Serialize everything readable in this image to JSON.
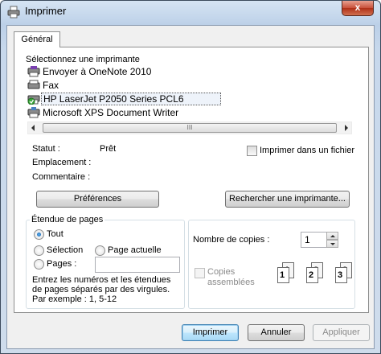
{
  "window": {
    "title": "Imprimer",
    "close_label": "x"
  },
  "tabs": [
    {
      "label": "Général"
    }
  ],
  "printer_group": {
    "legend": "Sélectionnez une imprimante",
    "printers": [
      {
        "name": "Envoyer à OneNote 2010",
        "icon": "onenote-printer-icon",
        "selected": false
      },
      {
        "name": "Fax",
        "icon": "fax-printer-icon",
        "selected": false
      },
      {
        "name": "HP LaserJet P2050 Series PCL6",
        "icon": "default-printer-icon",
        "selected": true
      },
      {
        "name": "Microsoft XPS Document Writer",
        "icon": "xps-printer-icon",
        "selected": false
      }
    ],
    "scroll_thumb_grip": "III",
    "status_label": "Statut :",
    "status_value": "Prêt",
    "location_label": "Emplacement :",
    "comment_label": "Commentaire :",
    "print_to_file_label": "Imprimer dans un fichier",
    "preferences_button": "Préférences",
    "find_printer_button": "Rechercher une imprimante..."
  },
  "range_group": {
    "legend": "Étendue de pages",
    "all_label": "Tout",
    "selection_label": "Sélection",
    "current_page_label": "Page actuelle",
    "pages_label": "Pages :",
    "pages_value": "",
    "help_text": "Entrez les numéros et les étendues de pages séparés par des virgules. Par exemple : 1, 5-12"
  },
  "copies_group": {
    "copies_label": "Nombre de copies :",
    "copies_value": "1",
    "collate_label_line1": "Copies",
    "collate_label_line2": "assemblées",
    "collate_pages": [
      "1",
      "1",
      "2",
      "2",
      "3",
      "3"
    ]
  },
  "footer": {
    "print_button": "Imprimer",
    "cancel_button": "Annuler",
    "apply_button": "Appliquer"
  },
  "colors": {
    "titlebar": "#bcd0e8",
    "close_button": "#c8503a",
    "default_button": "#bee6fd",
    "selected_item_border": "#555555"
  }
}
